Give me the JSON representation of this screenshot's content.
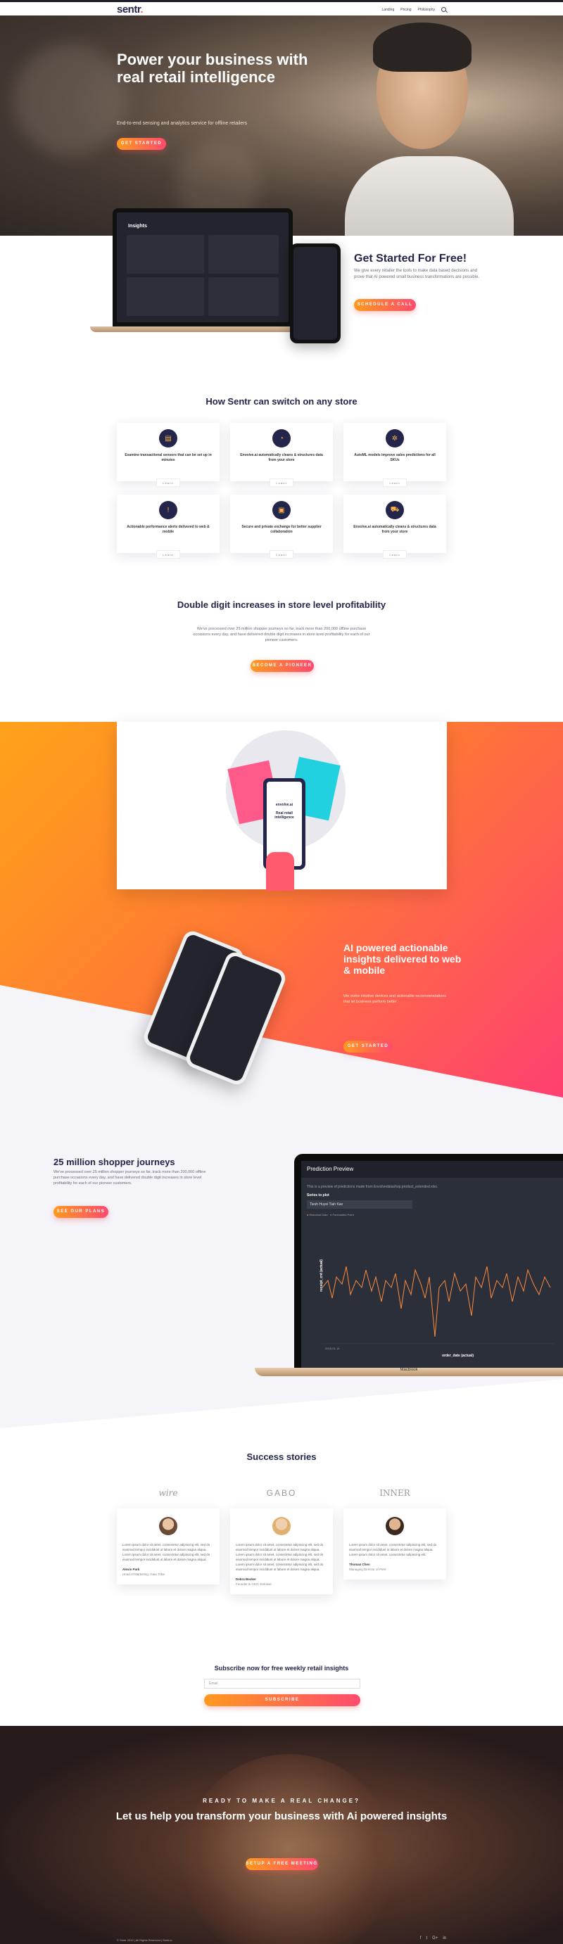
{
  "nav": {
    "logo": "sentr",
    "logo_dot": ".",
    "links": [
      "Landing",
      "Pricing",
      "Philosophy"
    ]
  },
  "hero": {
    "title": "Power your business with real retail intelligence",
    "subtitle": "End-to-end sensing and analytics service for offline retailers",
    "cta": "Get started"
  },
  "getstarted": {
    "title": "Get Started For Free!",
    "subtitle": "We give every retailer the tools to make data based decisions and prove that AI powered small business transformations are possible.",
    "cta": "Schedule a call",
    "dash_title": "Insights"
  },
  "how": {
    "title": "How Sentr can switch on any store",
    "link_label": "Learn",
    "features": [
      {
        "icon": "chart-icon",
        "glyph": "▤",
        "text": "Examine transactional sensors that can be set up in minutes"
      },
      {
        "icon": "pie-icon",
        "glyph": "◔",
        "text": "Envolve.ai automatically cleans & structures data from your store"
      },
      {
        "icon": "gear-icon",
        "glyph": "✲",
        "text": "AutoML models improve sales predictions for all SKUs"
      },
      {
        "icon": "alert-icon",
        "glyph": "!",
        "text": "Actionable performance alerts delivered to web & mobile"
      },
      {
        "icon": "lock-icon",
        "glyph": "▣",
        "text": "Secure and private exchange for better supplier collaboration"
      },
      {
        "icon": "cart-icon",
        "glyph": "⛟",
        "text": "Envolve.ai automatically cleans & structures data from your store"
      }
    ]
  },
  "double": {
    "title": "Double digit increases in store level profitability",
    "subtitle": "We've processed over 25 million shopper journeys so far, track more than 200,000 offline purchase occasions every day, and have delivered double digit increases in store level profitability for each of our pioneer customers.",
    "cta": "Become a pioneer"
  },
  "illustration": {
    "brand": "envolve.ai",
    "caption": "Real retail intelligence"
  },
  "ai": {
    "title": "AI powered actionable insights delivered to web & mobile",
    "subtitle": "We make intuitive devices and actionable recommendations that let business perform better.",
    "cta": "Get started"
  },
  "shopper": {
    "title": "25 million shopper journeys",
    "subtitle": "We've processed over 25 million shopper journeys so far, track more than 200,000 offline purchase occasions every day, and have delivered double digit increases in store level profitability for each of our pioneer customers.",
    "cta": "See our plans",
    "preview": {
      "header": "Prediction Preview",
      "desc": "This is a preview of predictions made from Envolvedatashop.product_extended.xlsx.",
      "series_label": "Series to plot",
      "series_value": "Tiesh Huyel Tiah Kao",
      "legend": [
        "Historical Data",
        "Forecasted Point"
      ],
      "ylabel": "receipt_cnt (actual)",
      "xlabel": "order_date (actual)",
      "date": "2018-01-14"
    },
    "mac_label": "MacBook"
  },
  "success": {
    "title": "Success stories",
    "brands": [
      "wire",
      "GABO",
      "INNER"
    ],
    "testimonials": [
      {
        "quote": "Lorem ipsum dolor sit amet, consectetur adipiscing elit, sed do eiusmod tempor incididunt ut labore et dolore magna aliqua. Lorem ipsum dolor sit amet, consectetur adipiscing elit, sed do eiusmod tempor incididunt ut labore et dolore magna aliqua.",
        "name": "Alexis Park",
        "role": "Head of Marketing, Gaia Tribe"
      },
      {
        "quote": "Lorem ipsum dolor sit amet, consectetur adipiscing elit, sed do eiusmod tempor incididunt ut labore et dolore magna aliqua. Lorem ipsum dolor sit amet, consectetur adipiscing elit, sed do eiusmod tempor incididunt ut labore et dolore magna aliqua. Lorem ipsum dolor sit amet, consectetur adipiscing elit, sed do eiusmod tempor incididunt ut labore et dolore magna aliqua.",
        "name": "Debra Becker",
        "role": "Founder & CEO, Entrisse"
      },
      {
        "quote": "Lorem ipsum dolor sit amet, consectetur adipiscing elit, sed do eiusmod tempor incididunt ut labore et dolore magna aliqua. Lorem ipsum dolor sit amet, consectetur adipiscing elit.",
        "name": "Thomas Chen",
        "role": "Managing Director of Piret"
      }
    ]
  },
  "subscribe": {
    "title": "Subscribe now for free weekly retail insights",
    "placeholder": "Email",
    "cta": "Subscribe"
  },
  "cta": {
    "eyebrow": "READY TO MAKE A REAL CHANGE?",
    "title": "Let us help you transform your business with Ai powered insights",
    "button": "Setup a free meeting"
  },
  "footer": {
    "copyright": "© Sentr 2019 | All Rights Reserved | Sentr.io",
    "socials": [
      "f",
      "t",
      "G+",
      "in"
    ]
  }
}
